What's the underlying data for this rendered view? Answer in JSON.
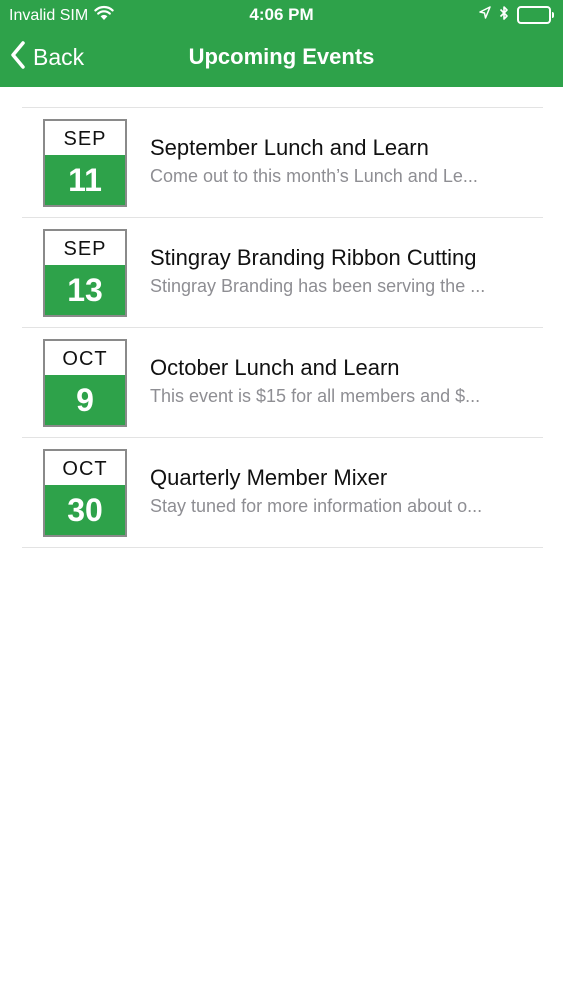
{
  "status_bar": {
    "carrier": "Invalid SIM",
    "time": "4:06 PM"
  },
  "nav": {
    "back_label": "Back",
    "title": "Upcoming Events"
  },
  "colors": {
    "accent": "#2ea24a",
    "date_border": "#8a8a8a",
    "subtitle": "#8e8e93",
    "divider": "#e3e3e3"
  },
  "events": [
    {
      "month": "SEP",
      "day": "11",
      "title": "September Lunch and Learn",
      "description": "Come out to this month’s Lunch and Le..."
    },
    {
      "month": "SEP",
      "day": "13",
      "title": "Stingray Branding Ribbon Cutting",
      "description": "Stingray Branding has been serving the ..."
    },
    {
      "month": "OCT",
      "day": "9",
      "title": "October Lunch and Learn",
      "description": "This event is $15 for all members and $..."
    },
    {
      "month": "OCT",
      "day": "30",
      "title": "Quarterly Member Mixer",
      "description": "Stay tuned for more information about o..."
    }
  ]
}
